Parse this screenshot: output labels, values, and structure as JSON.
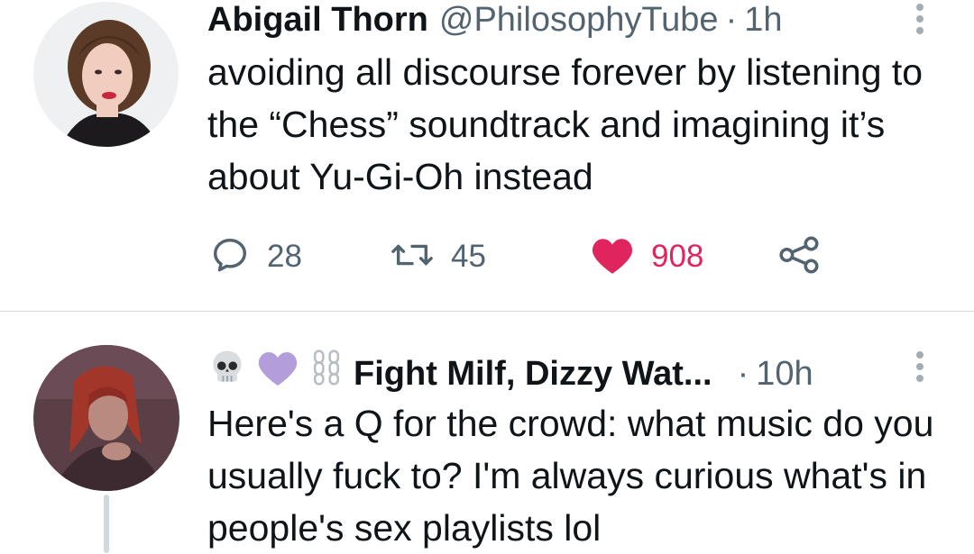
{
  "tweets": [
    {
      "display_name": "Abigail Thorn",
      "handle": "@PhilosophyTube",
      "separator": "·",
      "time": "1h",
      "text": "avoiding all discourse forever by listening to the “Chess” soundtrack and imagining it’s about Yu-Gi-Oh instead",
      "reply_count": "28",
      "retweet_count": "45",
      "like_count": "908",
      "liked": true
    },
    {
      "name_emojis": [
        "skull-emoji",
        "purple-heart-emoji",
        "chains-emoji"
      ],
      "display_name": "Fight Milf, Dizzy Wat...",
      "separator": "·",
      "time": "10h",
      "text": "Here's a Q for the crowd: what music do you usually fuck to? I'm always curious what's in people's sex playlists lol"
    }
  ],
  "colors": {
    "like": "#e0245e",
    "secondary_text": "#536471",
    "primary_text": "#0f1419",
    "divider": "#d6dbdf",
    "purple_heart": "#b39ddb"
  }
}
